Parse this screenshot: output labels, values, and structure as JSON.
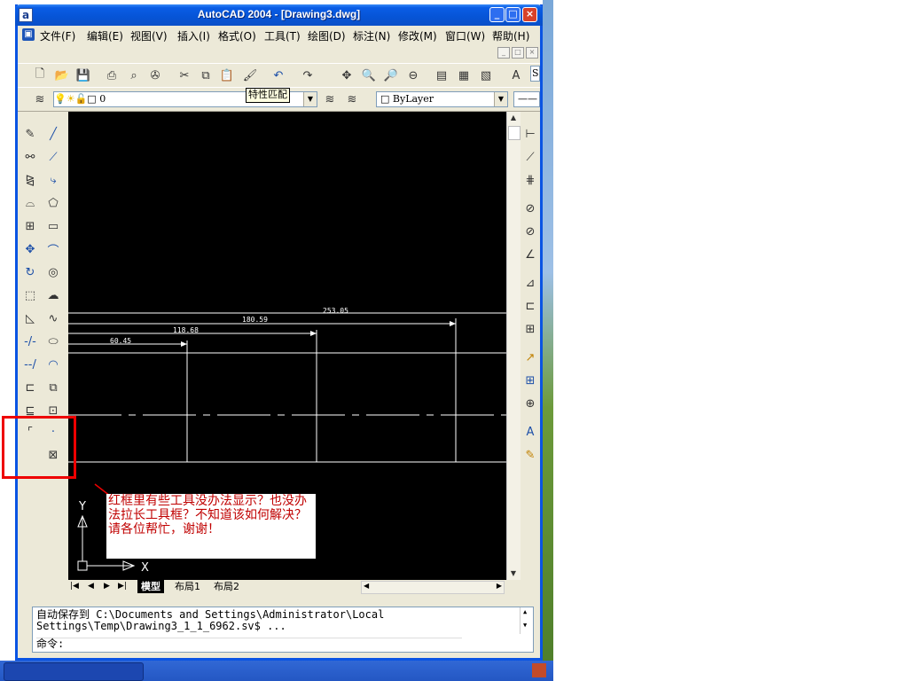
{
  "window": {
    "title": "AutoCAD 2004 - [Drawing3.dwg]",
    "icon": "a"
  },
  "title_buttons": {
    "minimize": "_",
    "maximize": "□",
    "close": "×"
  },
  "menu": [
    {
      "label": "文件(F)"
    },
    {
      "label": "编辑(E)"
    },
    {
      "label": "视图(V)"
    },
    {
      "label": "插入(I)"
    },
    {
      "label": "格式(O)"
    },
    {
      "label": "工具(T)"
    },
    {
      "label": "绘图(D)"
    },
    {
      "label": "标注(N)"
    },
    {
      "label": "修改(M)"
    },
    {
      "label": "窗口(W)"
    },
    {
      "label": "帮助(H)"
    }
  ],
  "layer": {
    "current": "0"
  },
  "tooltip": "特性匹配",
  "color_dropdown": {
    "value": "ByLayer"
  },
  "style_dropdown": {
    "value": "S"
  },
  "dimensions": [
    "253.05",
    "180.59",
    "118.68",
    "60.45"
  ],
  "ucs": {
    "y": "Y",
    "x": "X"
  },
  "tabs": [
    "模型",
    "布局1",
    "布局2"
  ],
  "command": {
    "line1": "自动保存到 C:\\Documents and Settings\\Administrator\\Local",
    "line2": "Settings\\Temp\\Drawing3_1_1_6962.sv$ ...",
    "prompt": "命令:"
  },
  "annotation": "红框里有些工具没办法显示？也没办法拉长工具框？不知道该如何解决？请各位帮忙，谢谢！",
  "colors": {
    "canvas": "#000000",
    "annotation_text": "#c00000",
    "highlight_box": "#e00000",
    "xp_blue": "#0a54e3"
  }
}
